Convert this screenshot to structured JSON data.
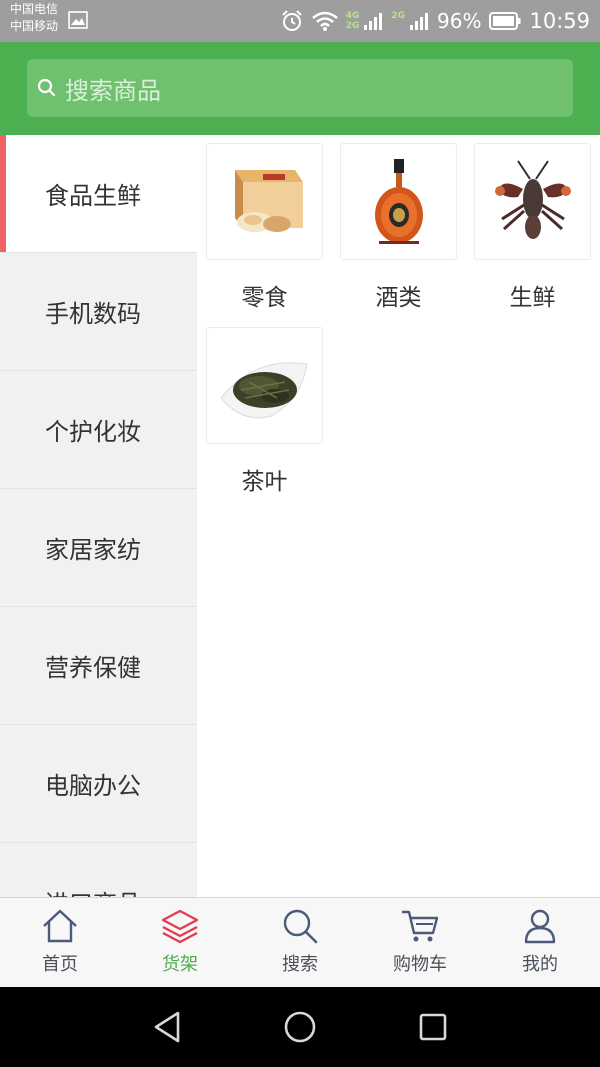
{
  "status_bar": {
    "carrier1": "中国电信",
    "carrier2": "中国移动",
    "net1": "4G",
    "net2": "2G",
    "net3": "2G",
    "battery": "96%",
    "time": "10:59"
  },
  "search": {
    "placeholder": "搜索商品"
  },
  "sidebar": {
    "items": [
      {
        "label": "食品生鲜",
        "active": true
      },
      {
        "label": "手机数码"
      },
      {
        "label": "个护化妆"
      },
      {
        "label": "家居家纺"
      },
      {
        "label": "营养保健"
      },
      {
        "label": "电脑办公"
      },
      {
        "label": "进口商品"
      }
    ]
  },
  "categories": [
    {
      "label": "零食",
      "icon": "snack-box-image"
    },
    {
      "label": "酒类",
      "icon": "cognac-bottle-image"
    },
    {
      "label": "生鲜",
      "icon": "lobster-image"
    },
    {
      "label": "茶叶",
      "icon": "tea-leaves-image"
    }
  ],
  "tabbar": {
    "items": [
      {
        "label": "首页",
        "icon": "home-icon"
      },
      {
        "label": "货架",
        "icon": "layers-icon",
        "active": true
      },
      {
        "label": "搜索",
        "icon": "search-icon"
      },
      {
        "label": "购物车",
        "icon": "cart-icon"
      },
      {
        "label": "我的",
        "icon": "user-icon"
      }
    ]
  },
  "colors": {
    "primary": "#4caf50",
    "active_indicator": "#f06363",
    "tab_active_icon": "#e23b54"
  }
}
